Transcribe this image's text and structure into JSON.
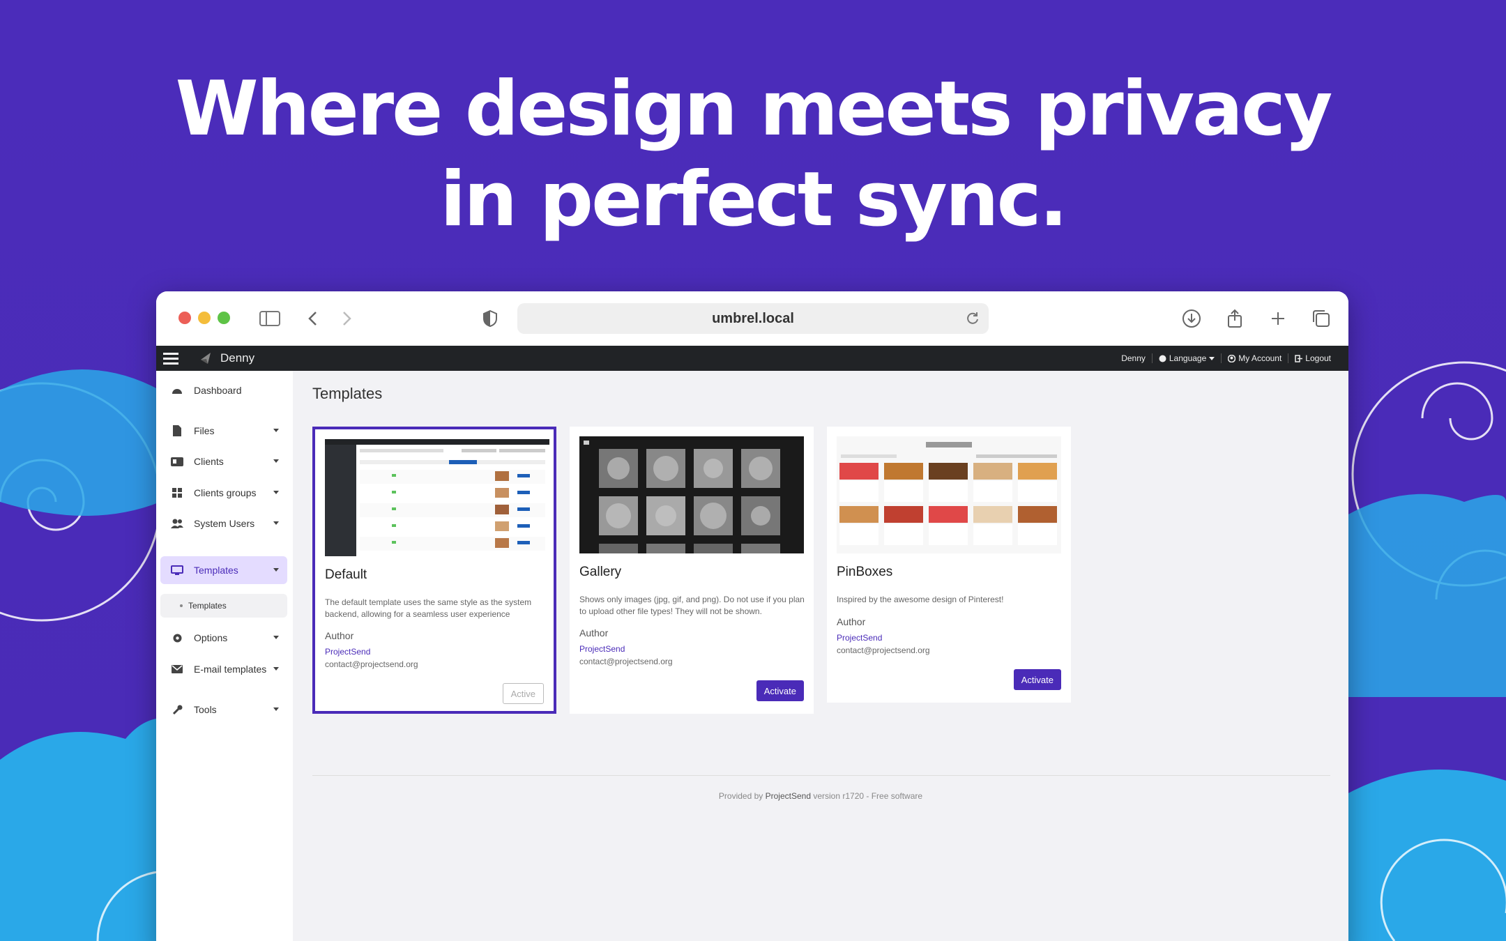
{
  "headline": {
    "line1": "Where design meets privacy",
    "line2": "in perfect sync."
  },
  "browser": {
    "url": "umbrel.local"
  },
  "app": {
    "brand": "Denny",
    "topnav": {
      "user": "Denny",
      "language": "Language",
      "account": "My Account",
      "logout": "Logout"
    },
    "sidebar": {
      "items": [
        {
          "label": "Dashboard",
          "icon": "dashboard-icon"
        },
        {
          "label": "Files",
          "icon": "file-icon"
        },
        {
          "label": "Clients",
          "icon": "id-card-icon"
        },
        {
          "label": "Clients groups",
          "icon": "grid-icon"
        },
        {
          "label": "System Users",
          "icon": "users-icon"
        },
        {
          "label": "Templates",
          "icon": "desktop-icon"
        },
        {
          "label": "Options",
          "icon": "gear-icon"
        },
        {
          "label": "E-mail templates",
          "icon": "envelope-icon"
        },
        {
          "label": "Tools",
          "icon": "wrench-icon"
        }
      ],
      "subitem": "Templates"
    },
    "page_title": "Templates",
    "cards": [
      {
        "title": "Default",
        "description": "The default template uses the same style as the system backend, allowing for a seamless user experience",
        "author_label": "Author",
        "author": "ProjectSend",
        "email": "contact@projectsend.org",
        "button": "Active"
      },
      {
        "title": "Gallery",
        "description": "Shows only images (jpg, gif, and png). Do not use if you plan to upload other file types! They will not be shown.",
        "author_label": "Author",
        "author": "ProjectSend",
        "email": "contact@projectsend.org",
        "button": "Activate"
      },
      {
        "title": "PinBoxes",
        "description": "Inspired by the awesome design of Pinterest!",
        "author_label": "Author",
        "author": "ProjectSend",
        "email": "contact@projectsend.org",
        "button": "Activate"
      }
    ],
    "footer": {
      "prefix": "Provided by ",
      "link": "ProjectSend",
      "suffix": " version r1720 - Free software"
    }
  },
  "colors": {
    "accent": "#4a2bb8",
    "background": "#4b2cba",
    "cloud_blue": "#2aa8e8",
    "topnav": "#212326"
  }
}
